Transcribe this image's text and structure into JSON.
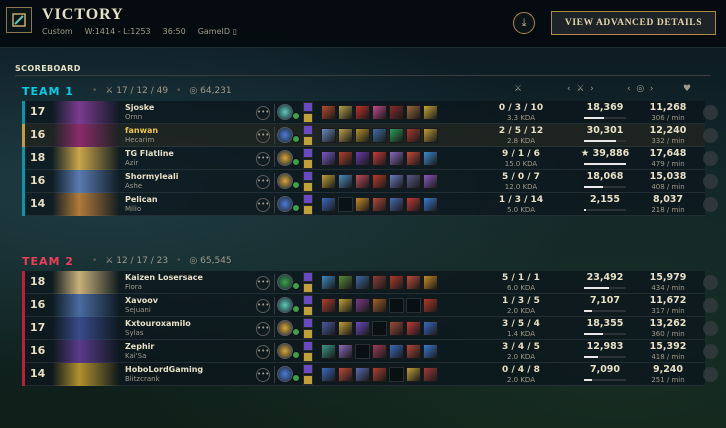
{
  "header": {
    "title": "VICTORY",
    "mode": "Custom",
    "record": "W:1414 - L:1253",
    "duration": "36:50",
    "game_id_label": "GameID",
    "advanced_button": "VIEW ADVANCED DETAILS"
  },
  "scoreboard_label": "SCOREBOARD",
  "teams": [
    {
      "name": "TEAM 1",
      "kda": "17 / 12 / 49",
      "gold": "64,231",
      "players": [
        {
          "level": "17",
          "name": "Sjoske",
          "champion": "Ornn",
          "kda": "0 / 3 / 10",
          "kda_ratio": "3.3 KDA",
          "damage": "18,369",
          "damage_fraction": 0.47,
          "gold": "11,268",
          "gpm": "306 / min",
          "portrait_color": "#7a3b8f",
          "rune_color": "#5ec8b8",
          "items": [
            "#b54d2c",
            "#b4a24a",
            "#c2302a",
            "#c04a8a",
            "#8a2b2b",
            "#9a6a3c",
            "#c6a83a"
          ]
        },
        {
          "level": "16",
          "name": "fanwan",
          "champion": "Hecarim",
          "kda": "2 / 5 / 12",
          "kda_ratio": "2.8 KDA",
          "damage": "30,301",
          "damage_fraction": 0.76,
          "gold": "12,240",
          "gpm": "332 / min",
          "portrait_color": "#8a2c6a",
          "rune_color": "#4d7ad6",
          "items": [
            "#6a8ac0",
            "#b9a14c",
            "#b0902e",
            "#3c6ea6",
            "#2e9a5a",
            "#a53a2e",
            "#c09a3a"
          ]
        },
        {
          "level": "18",
          "name": "TG Flatline",
          "champion": "Azir",
          "kda": "9 / 1 / 6",
          "kda_ratio": "15.0 KDA",
          "damage": "39,886",
          "damage_fraction": 1.0,
          "gold": "17,648",
          "gpm": "479 / min",
          "portrait_color": "#c9a54a",
          "rune_color": "#d9a23a",
          "items": [
            "#7a5ac8",
            "#b0402e",
            "#6a3aa8",
            "#c53a3a",
            "#8a6ac0",
            "#c44a3a",
            "#3a8ad0"
          ]
        },
        {
          "level": "16",
          "name": "Shormyleali",
          "champion": "Ashe",
          "kda": "5 / 0 / 7",
          "kda_ratio": "12.0 KDA",
          "damage": "18,068",
          "damage_fraction": 0.45,
          "gold": "15,038",
          "gpm": "408 / min",
          "portrait_color": "#5a7ab0",
          "rune_color": "#d9a23a",
          "items": [
            "#c0a03a",
            "#4a8ac0",
            "#c04a5a",
            "#b83a2a",
            "#6a7ac0",
            "#5a5a8a",
            "#8a5ac0"
          ]
        },
        {
          "level": "14",
          "name": "Pelican",
          "champion": "Milio",
          "kda": "1 / 3 / 14",
          "kda_ratio": "5.0 KDA",
          "damage": "2,155",
          "damage_fraction": 0.05,
          "gold": "8,037",
          "gpm": "218 / min",
          "portrait_color": "#b07a3a",
          "rune_color": "#4d7ad6",
          "items": [
            "#3a6ac0",
            "#2a2f33",
            "#c88a2a",
            "#b04a3a",
            "#4a6ab0",
            "#c03a3a",
            "#3a7ad0"
          ]
        }
      ]
    },
    {
      "name": "TEAM 2",
      "kda": "12 / 17 / 23",
      "gold": "65,545",
      "players": [
        {
          "level": "18",
          "name": "Kaizen Losersace",
          "champion": "Fiora",
          "kda": "5 / 1 / 1",
          "kda_ratio": "6.0 KDA",
          "damage": "23,492",
          "damage_fraction": 0.59,
          "gold": "15,979",
          "gpm": "434 / min",
          "portrait_color": "#c8b07a",
          "rune_color": "#3aa04a",
          "items": [
            "#3a8ac0",
            "#5a8a3a",
            "#3a6aa0",
            "#8a3a3a",
            "#b03a2a",
            "#c04a3a",
            "#c88a2a"
          ]
        },
        {
          "level": "16",
          "name": "Xavoov",
          "champion": "Sejuani",
          "kda": "1 / 3 / 5",
          "kda_ratio": "2.0 KDA",
          "damage": "7,107",
          "damage_fraction": 0.18,
          "gold": "11,672",
          "gpm": "317 / min",
          "portrait_color": "#4a6aa0",
          "rune_color": "#5ec8b8",
          "items": [
            "#b0402e",
            "#c0a03a",
            "#7a3a8a",
            "#a0602a",
            "#2a2f33",
            "#2a2f33",
            "#b03a2a"
          ]
        },
        {
          "level": "17",
          "name": "Kxtouroxamilo",
          "champion": "Sylas",
          "kda": "3 / 5 / 4",
          "kda_ratio": "1.4 KDA",
          "damage": "18,355",
          "damage_fraction": 0.46,
          "gold": "13,262",
          "gpm": "360 / min",
          "portrait_color": "#3a4a8a",
          "rune_color": "#d9a23a",
          "items": [
            "#4a5aa0",
            "#c0a03a",
            "#6a4ac0",
            "#2a2f33",
            "#a04a3a",
            "#c03a3a",
            "#3a6ac0"
          ]
        },
        {
          "level": "16",
          "name": "Zephir",
          "champion": "Kai'Sa",
          "kda": "3 / 4 / 5",
          "kda_ratio": "2.0 KDA",
          "damage": "12,983",
          "damage_fraction": 0.33,
          "gold": "15,392",
          "gpm": "418 / min",
          "portrait_color": "#5a3a8a",
          "rune_color": "#d9a23a",
          "items": [
            "#3a9a8a",
            "#8a6ac0",
            "#2a2f33",
            "#a03a5a",
            "#3a6ac0",
            "#b04a3a",
            "#3a7ad0"
          ]
        },
        {
          "level": "14",
          "name": "HoboLordGaming",
          "champion": "Blitzcrank",
          "kda": "0 / 4 / 8",
          "kda_ratio": "2.0 KDA",
          "damage": "7,090",
          "damage_fraction": 0.18,
          "gold": "9,240",
          "gpm": "251 / min",
          "portrait_color": "#b0902e",
          "rune_color": "#4d7ad6",
          "items": [
            "#3a6ac0",
            "#c04a3a",
            "#5a6ab0",
            "#b0402e",
            "#2a2f33",
            "#c0a03a",
            "#a03a3a"
          ]
        }
      ]
    }
  ],
  "top_damage_star": "★"
}
